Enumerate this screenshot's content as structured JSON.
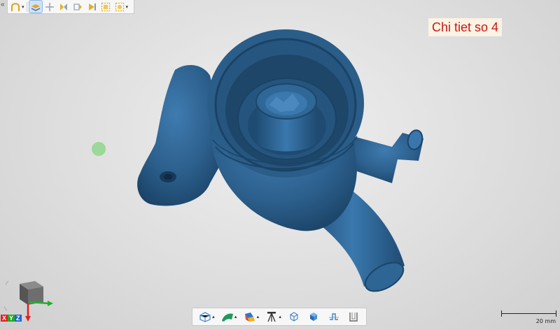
{
  "title": "Chi tiet so 4",
  "top_toolbar": {
    "collapse_glyph": "«",
    "items": [
      {
        "name": "selection-mode-icon",
        "has_dropdown": true
      },
      {
        "name": "layers-icon",
        "active": true
      },
      {
        "name": "move-arrows-icon"
      },
      {
        "name": "flip-yellow-icon"
      },
      {
        "name": "flip-yellow-2-icon"
      },
      {
        "name": "flip-yellow-3-icon"
      },
      {
        "name": "frame-select-icon"
      },
      {
        "name": "frame-select-2-icon",
        "has_dropdown": true
      }
    ]
  },
  "bottom_toolbar": {
    "items": [
      {
        "name": "mesh-render-icon",
        "has_dropdown": true
      },
      {
        "name": "surface-green-icon",
        "has_dropdown": true
      },
      {
        "name": "color-texture-icon",
        "has_dropdown": true
      },
      {
        "name": "tripod-icon",
        "has_dropdown": true
      },
      {
        "name": "box-wireframe-icon"
      },
      {
        "name": "box-solid-icon"
      },
      {
        "name": "section-curve-icon"
      },
      {
        "name": "deviation-icon"
      }
    ]
  },
  "scale_bar": {
    "label": "20 mm"
  },
  "gizmo": {
    "x": "X",
    "y": "Y",
    "z": "Z"
  },
  "colors": {
    "model": "#2f6491",
    "model_dark": "#1e4a70",
    "title_text": "#c81818",
    "title_bg": "#fbf3e3",
    "pivot": "#8fd68a"
  }
}
